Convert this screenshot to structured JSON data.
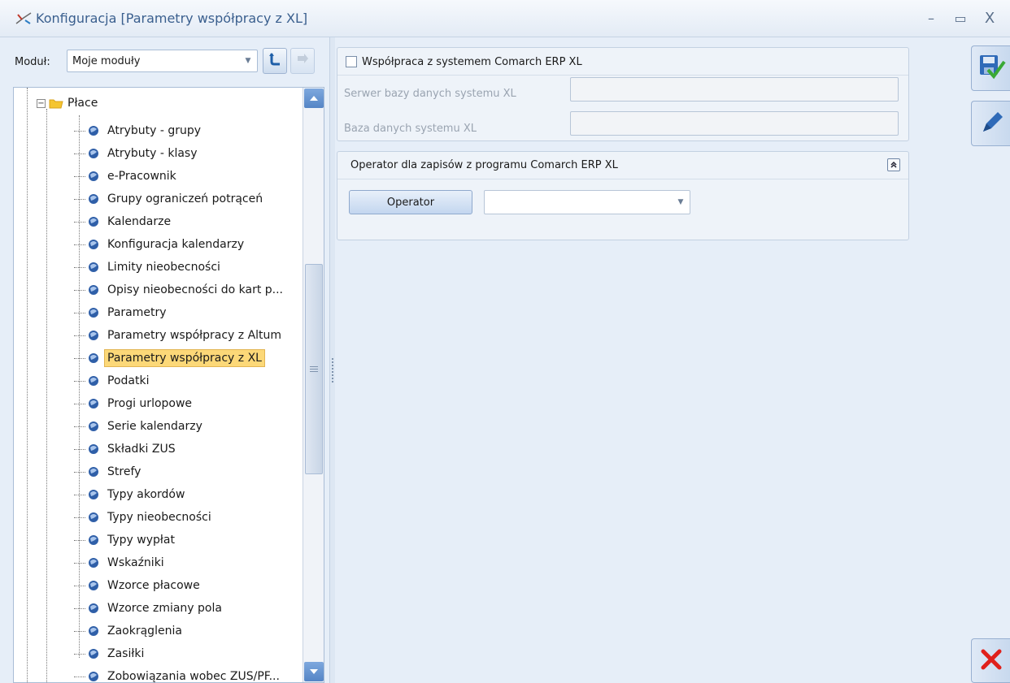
{
  "window": {
    "title": "Konfiguracja [Parametry współpracy z XL]",
    "minimize_glyph": "–",
    "maximize_glyph": "▭",
    "close_glyph": "X"
  },
  "sidebar": {
    "module_label": "Moduł:",
    "module_value": "Moje moduły",
    "tree_root": "Płace",
    "tree_items": [
      "Atrybuty - grupy",
      "Atrybuty - klasy",
      "e-Pracownik",
      "Grupy ograniczeń potrąceń",
      "Kalendarze",
      "Konfiguracja kalendarzy",
      "Limity nieobecności",
      "Opisy nieobecności do kart p...",
      "Parametry",
      "Parametry współpracy z Altum",
      "Parametry współpracy z XL",
      "Podatki",
      "Progi urlopowe",
      "Serie kalendarzy",
      "Składki ZUS",
      "Strefy",
      "Typy akordów",
      "Typy nieobecności",
      "Typy wypłat",
      "Wskaźniki",
      "Wzorce płacowe",
      "Wzorce zmiany pola",
      "Zaokrąglenia",
      "Zasiłki",
      "Zobowiązania wobec ZUS/PF..."
    ],
    "selected_index": 10
  },
  "cooperation": {
    "checkbox_label": "Współpraca z systemem Comarch ERP XL",
    "checked": false,
    "server_label": "Serwer bazy danych systemu XL",
    "server_value": "",
    "database_label": "Baza danych systemu XL",
    "database_value": ""
  },
  "operator_section": {
    "header": "Operator dla zapisów z programu Comarch ERP XL",
    "button_label": "Operator",
    "selected_value": ""
  },
  "colors": {
    "accent": "#3a5f8e",
    "selection": "#fcd878",
    "panel": "#e6eef8",
    "cancel": "#e0201b",
    "save_check": "#3aa935"
  },
  "icons": {
    "title": "config-icon",
    "tree_folder": "folder-icon",
    "tree_leaf": "blue-globe-icon",
    "toolbar": [
      "refresh-icon",
      "disabled-action-icon"
    ],
    "side": [
      "save-icon",
      "edit-icon",
      "cancel-icon"
    ]
  }
}
